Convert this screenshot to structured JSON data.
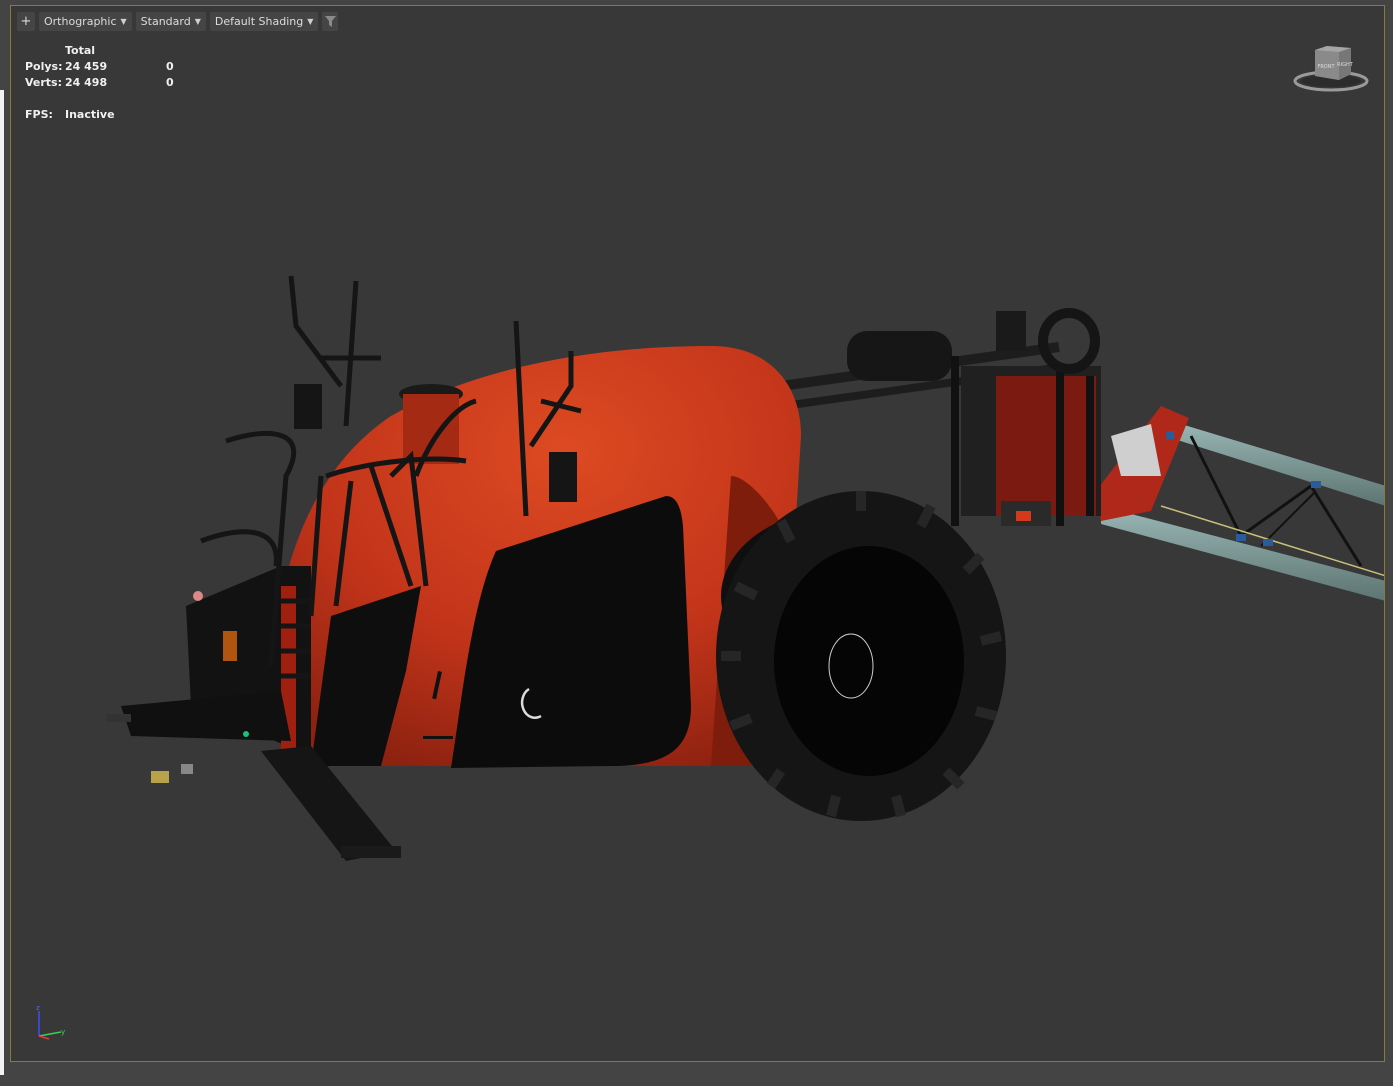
{
  "viewport": {
    "menu": {
      "plus_label": "+",
      "projection_label": "Orthographic",
      "display_label": "Standard",
      "shading_label": "Default Shading",
      "filter_icon": "filter-icon"
    },
    "stats": {
      "header": "Total",
      "polys_label": "Polys:",
      "polys_total": "24 459",
      "polys_selected": "0",
      "verts_label": "Verts:",
      "verts_total": "24 498",
      "verts_selected": "0",
      "fps_label": "FPS:",
      "fps_value": "Inactive"
    },
    "viewcube": {
      "face_left": "FRONT",
      "face_right": "RIGHT"
    },
    "axis_labels": {
      "z": "z",
      "y": "y"
    },
    "colors": {
      "viewport_bg": "#383838",
      "active_border": "#8c7a2e",
      "tank_orange": "#c8361a",
      "boom_steel": "#7f9c9a"
    }
  }
}
